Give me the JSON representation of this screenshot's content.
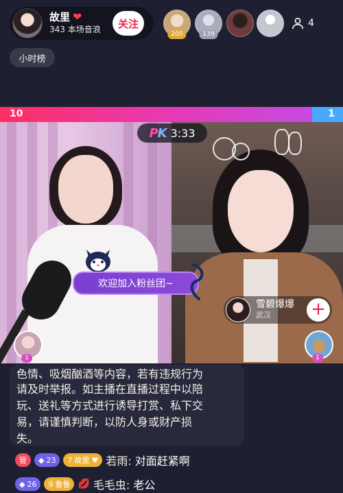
{
  "host": {
    "name": "故里",
    "subtitle": "343 本场音浪",
    "follow_label": "关注"
  },
  "viewers": [
    {
      "badge": "200",
      "color": "#c9a77a"
    },
    {
      "badge": "139",
      "color": "#a8acbc"
    },
    {
      "badge": "",
      "color": "#6e3a3a"
    },
    {
      "badge": "",
      "color": "#c4c6d0"
    }
  ],
  "viewer_count": "4",
  "rank_label": "小时榜",
  "pk": {
    "left_score": "10",
    "right_score": "1",
    "logo_p": "P",
    "logo_k": "K",
    "time": "3:33",
    "left_share": 0.91
  },
  "fan_banner": "欢迎加入粉丝团~",
  "guest": {
    "name": "雪碧爆爆",
    "location": "武汉",
    "add_symbol": "+"
  },
  "seats": {
    "left_badge": "1",
    "right_badge": "1"
  },
  "notice_lines": [
    "色情、吸烟酗酒等内容，若有违规行为",
    "请及时举报。如主播在直播过程中以陪",
    "玩、送礼等方式进行诱导打赏、私下交",
    "易，请谨慎判断，以防人身或财产损",
    "失。"
  ],
  "chat": [
    {
      "badges": [
        {
          "type": "admin",
          "text": "管"
        },
        {
          "type": "level",
          "text": "23"
        },
        {
          "type": "fan",
          "text": "故里",
          "prefix": "7"
        }
      ],
      "user": "若雨:",
      "message": "对面赶紧啊"
    },
    {
      "badges": [
        {
          "type": "level",
          "text": "26"
        },
        {
          "type": "fan",
          "text": "鲁鲁",
          "prefix": "9"
        }
      ],
      "user": "毛毛虫:",
      "message": "老公"
    }
  ],
  "colors": {
    "background": "#1e2032",
    "pk_left": "#ff2e63",
    "pk_right": "#4aa8ff",
    "accent": "#e8284f"
  }
}
